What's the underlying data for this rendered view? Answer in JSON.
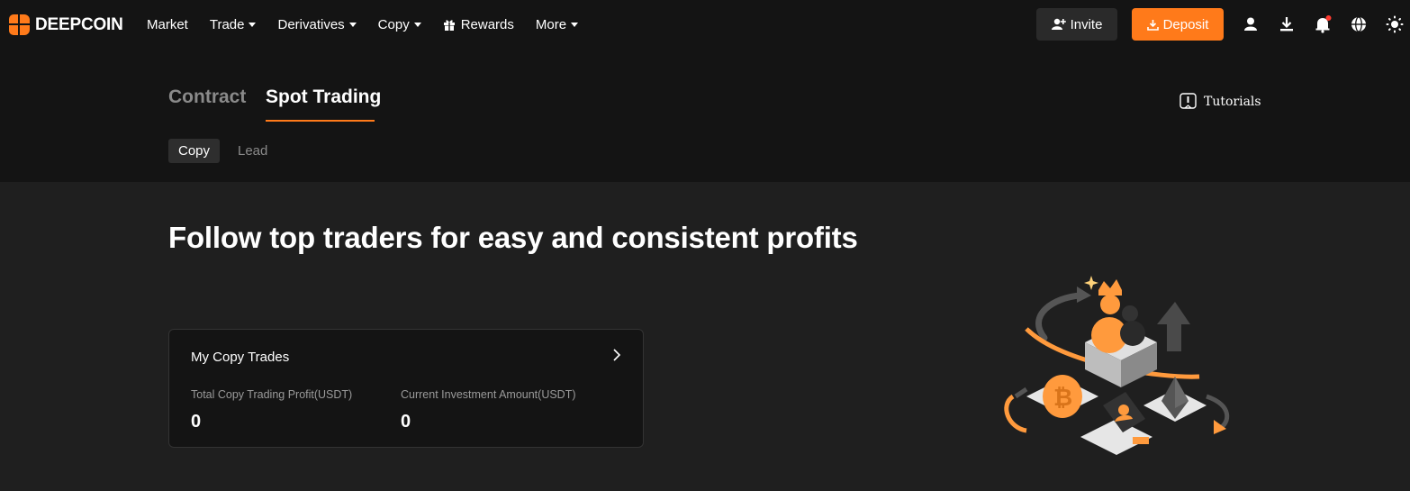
{
  "brand": {
    "name": "DEEPCOIN",
    "accent": "#ff7a1a"
  },
  "nav": {
    "items": [
      {
        "label": "Market",
        "dropdown": false
      },
      {
        "label": "Trade",
        "dropdown": true
      },
      {
        "label": "Derivatives",
        "dropdown": true
      },
      {
        "label": "Copy",
        "dropdown": true
      },
      {
        "label": "Rewards",
        "dropdown": false,
        "icon": "gift-icon"
      },
      {
        "label": "More",
        "dropdown": true
      }
    ],
    "invite_label": "Invite",
    "deposit_label": "Deposit",
    "right_icons": [
      "user-icon",
      "download-icon",
      "bell-icon",
      "globe-icon",
      "theme-icon"
    ]
  },
  "tabs": {
    "contract": "Contract",
    "spot": "Spot Trading",
    "active": "Spot Trading"
  },
  "tutorials_label": "Tutorials",
  "subtabs": {
    "copy": "Copy",
    "lead": "Lead",
    "active": "Copy"
  },
  "headline": "Follow top traders for easy and consistent profits",
  "card": {
    "title": "My Copy Trades",
    "stats": [
      {
        "label": "Total Copy Trading Profit(USDT)",
        "value": "0"
      },
      {
        "label": "Current Investment Amount(USDT)",
        "value": "0"
      }
    ]
  }
}
